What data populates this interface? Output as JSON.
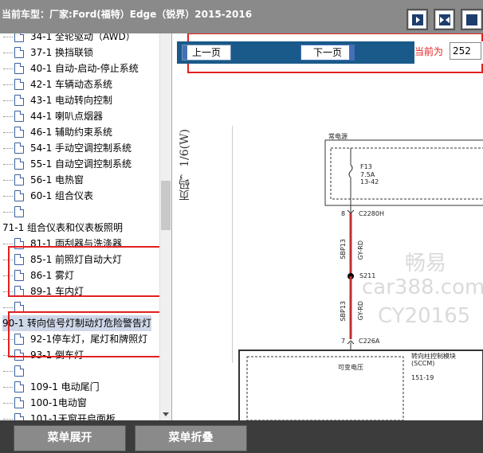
{
  "title": {
    "label": "当前车型：",
    "manufacturer": "厂家:Ford(福特）Edge（锐界）2015-2016"
  },
  "tree": {
    "items": [
      {
        "label": "34-1 全轮驱动（AWD）",
        "indent": 1
      },
      {
        "label": "37-1 换挡联锁",
        "indent": 1
      },
      {
        "label": "40-1 自动-启动-停止系统",
        "indent": 1
      },
      {
        "label": "42-1 车辆动态系统",
        "indent": 1
      },
      {
        "label": "43-1 电动转向控制",
        "indent": 1
      },
      {
        "label": "44-1 喇叭点烟器",
        "indent": 1
      },
      {
        "label": "46-1 辅助约束系统",
        "indent": 1
      },
      {
        "label": "54-1 手动空调控制系统",
        "indent": 1
      },
      {
        "label": "55-1 自动空调控制系统",
        "indent": 1
      },
      {
        "label": "56-1 电热窗",
        "indent": 1
      },
      {
        "label": "60-1 组合仪表",
        "indent": 1
      },
      {
        "label": "",
        "indent": 1
      },
      {
        "label": "71-1 组合仪表和仪表板照明",
        "indent": 0
      },
      {
        "label": "81-1 雨刮器与洗涤器",
        "indent": 1
      },
      {
        "label": "85-1 前照灯自动大灯",
        "indent": 1
      },
      {
        "label": "86-1 雾灯",
        "indent": 1
      },
      {
        "label": "89-1 车内灯",
        "indent": 1
      },
      {
        "label": "",
        "indent": 1
      },
      {
        "label": "90-1 转向信号灯制动灯危险警告灯",
        "indent": 0,
        "selected": true
      },
      {
        "label": "92-1停车灯，尾灯和牌照灯",
        "indent": 1
      },
      {
        "label": "93-1 倒车灯",
        "indent": 1
      },
      {
        "label": "",
        "indent": 1
      },
      {
        "label": "109-1 电动尾门",
        "indent": 1
      },
      {
        "label": "100-1电动窗",
        "indent": 1
      },
      {
        "label": "101-1天窗开启面板",
        "indent": 1
      },
      {
        "label": "112-1 被动防盗系统",
        "indent": 1
      }
    ]
  },
  "nav": {
    "prev_label": "上一页",
    "next_label": "下一页",
    "current_label": "当前为",
    "page_value": "252"
  },
  "viewer": {
    "side_label": "页码，1/6(W)",
    "watermark_1": "畅易",
    "watermark_2": "car388.com",
    "watermark_3": "CY20165"
  },
  "diagram": {
    "power_label": "常电源",
    "fuse_name": "F13",
    "fuse_rating": "7.5A",
    "fuse_ref": "13-42",
    "connector_1_pin": "8",
    "connector_1": "C2280H",
    "wire_code_1": "SBP13",
    "wire_color_1": "GY-RD",
    "splice": "S211",
    "wire_code_2": "SBP13",
    "wire_color_2": "GY-RD",
    "connector_2_pin": "7",
    "connector_2": "C226A",
    "module_name": "转向柱控制模块",
    "module_abbr": "(SCCM)",
    "module_ref": "151-19",
    "variable_voltage": "可变电压"
  },
  "bottom": {
    "expand_label": "菜单展开",
    "collapse_label": "菜单折叠"
  },
  "colors": {
    "accent_red": "#e02020",
    "navbar_blue": "#1a5a8a",
    "titlebar_gray": "#8a8a8a",
    "wire_red": "#c03030"
  }
}
